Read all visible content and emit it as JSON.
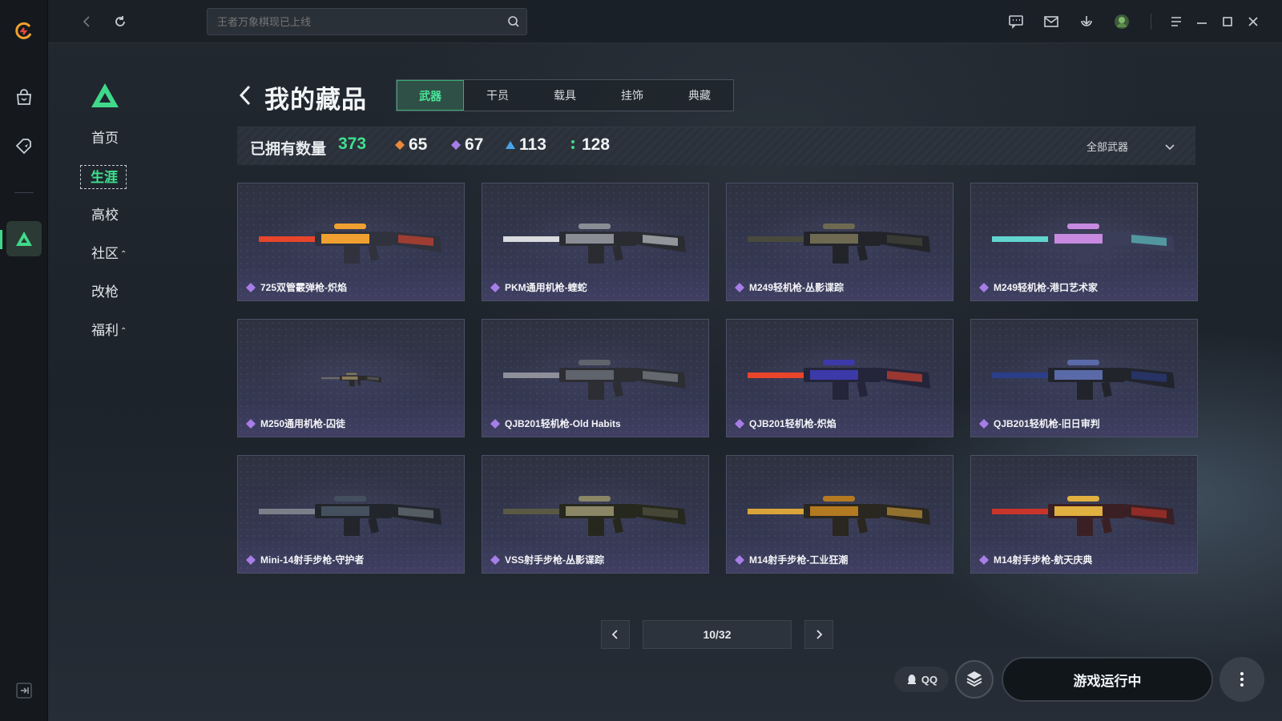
{
  "app": {
    "search_placeholder": "王者万象棋现已上线"
  },
  "nav": {
    "items": [
      {
        "label": "首页",
        "caret": false,
        "active": false
      },
      {
        "label": "生涯",
        "caret": false,
        "active": true
      },
      {
        "label": "高校",
        "caret": false,
        "active": false
      },
      {
        "label": "社区",
        "caret": true,
        "active": false
      },
      {
        "label": "改枪",
        "caret": false,
        "active": false
      },
      {
        "label": "福利",
        "caret": true,
        "active": false
      }
    ],
    "caret_glyph": "⌃"
  },
  "page": {
    "title": "我的藏品",
    "tabs": [
      {
        "label": "武器",
        "active": true
      },
      {
        "label": "干员",
        "active": false
      },
      {
        "label": "载具",
        "active": false
      },
      {
        "label": "挂饰",
        "active": false
      },
      {
        "label": "典藏",
        "active": false
      }
    ]
  },
  "stats": {
    "owned_label": "已拥有数量",
    "owned_total": "373",
    "rarities": [
      {
        "icon": "orange-diamond-icon",
        "color": "#e8893a",
        "count": "65"
      },
      {
        "icon": "purple-diamond-icon",
        "color": "#a77de8",
        "count": "67"
      },
      {
        "icon": "blue-triangle-icon",
        "color": "#4aa3e8",
        "count": "113"
      },
      {
        "icon": "green-dots-icon",
        "color": "#3fd98a",
        "count": "128"
      }
    ],
    "filter_label": "全部武器"
  },
  "items": [
    {
      "name": "725双管霰弹枪-炽焰",
      "palette": [
        "#e8452a",
        "#f0a030",
        "#30323e"
      ]
    },
    {
      "name": "PKM通用机枪-蝰蛇",
      "palette": [
        "#d9dcde",
        "#8a8d93",
        "#2a2c32"
      ]
    },
    {
      "name": "M249轻机枪-丛影谍踪",
      "palette": [
        "#4a4a3c",
        "#6e6a52",
        "#22242a"
      ]
    },
    {
      "name": "M249轻机枪-港口艺术家",
      "palette": [
        "#62d4d0",
        "#c78ae0",
        "#3a3e58"
      ]
    },
    {
      "name": "M250通用机枪-囚徒",
      "palette": [
        "#6b6b6b",
        "#8a7a5a",
        "#2a2a2a"
      ]
    },
    {
      "name": "QJB201轻机枪-Old Habits",
      "palette": [
        "#8d9099",
        "#5f636c",
        "#2c2e34"
      ]
    },
    {
      "name": "QJB201轻机枪-炽焰",
      "palette": [
        "#e8452a",
        "#3c3aa8",
        "#24243a"
      ]
    },
    {
      "name": "QJB201轻机枪-旧日审判",
      "palette": [
        "#2a3e8a",
        "#5a6aa8",
        "#22242c"
      ]
    },
    {
      "name": "Mini-14射手步枪-守护者",
      "palette": [
        "#7a808a",
        "#45505e",
        "#22262c"
      ]
    },
    {
      "name": "VSS射手步枪-丛影谍踪",
      "palette": [
        "#5a5a44",
        "#8a8666",
        "#26281e"
      ]
    },
    {
      "name": "M14射手步枪-工业狂潮",
      "palette": [
        "#d9a43a",
        "#b37a22",
        "#2a2620"
      ]
    },
    {
      "name": "M14射手步枪-航天庆典",
      "palette": [
        "#c8352a",
        "#e0b040",
        "#3a2024"
      ]
    }
  ],
  "pagination": {
    "current": 10,
    "total": 32,
    "display": "10/32"
  },
  "footer": {
    "qq_label": "QQ",
    "run_label": "游戏运行中"
  },
  "colors": {
    "accent": "#3fe08f",
    "rarity_purple": "#a77de8"
  }
}
